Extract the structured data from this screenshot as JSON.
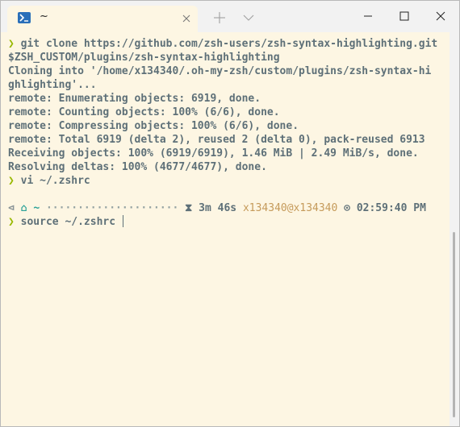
{
  "window": {
    "tab_title": "~",
    "tab_icon": "powershell-icon",
    "new_tab_icon": "plus-icon",
    "dropdown_icon": "chevron-down-icon",
    "minimize_icon": "minimize-icon",
    "maximize_icon": "maximize-icon",
    "close_icon": "close-icon"
  },
  "colors": {
    "background": "#fdf6e3",
    "text": "#5e7078",
    "prompt": "#98b800",
    "accent": "#2aa198",
    "user_host": "#c59a5a"
  },
  "terminal": {
    "prompt_symbol": "❯",
    "lines": [
      {
        "prompt": true,
        "text": "git clone https://github.com/zsh-users/zsh-syntax-highlighting.git"
      },
      {
        "prompt": false,
        "text": "$ZSH_CUSTOM/plugins/zsh-syntax-highlighting"
      },
      {
        "prompt": false,
        "text": "Cloning into '/home/x134340/.oh-my-zsh/custom/plugins/zsh-syntax-hi"
      },
      {
        "prompt": false,
        "text": "ghlighting'..."
      },
      {
        "prompt": false,
        "text": "remote: Enumerating objects: 6919, done."
      },
      {
        "prompt": false,
        "text": "remote: Counting objects: 100% (6/6), done."
      },
      {
        "prompt": false,
        "text": "remote: Compressing objects: 100% (6/6), done."
      },
      {
        "prompt": false,
        "text": "remote: Total 6919 (delta 2), reused 2 (delta 0), pack-reused 6913"
      },
      {
        "prompt": false,
        "text": "Receiving objects: 100% (6919/6919), 1.46 MiB | 2.49 MiB/s, done."
      },
      {
        "prompt": false,
        "text": "Resolving deltas: 100% (4677/4677), done."
      },
      {
        "prompt": true,
        "text": "vi ~/.zshrc"
      }
    ],
    "status_line": {
      "left_glyph": "⊲",
      "home_glyph": "⌂",
      "dir": "~",
      "dots": "·····················",
      "timer_glyph": "⧗",
      "duration": "3m 46s",
      "user_host": "x134340@x134340",
      "clock_glyph": "⊙",
      "time": "02:59:40 PM"
    },
    "current_command": "source ~/.zshrc"
  }
}
